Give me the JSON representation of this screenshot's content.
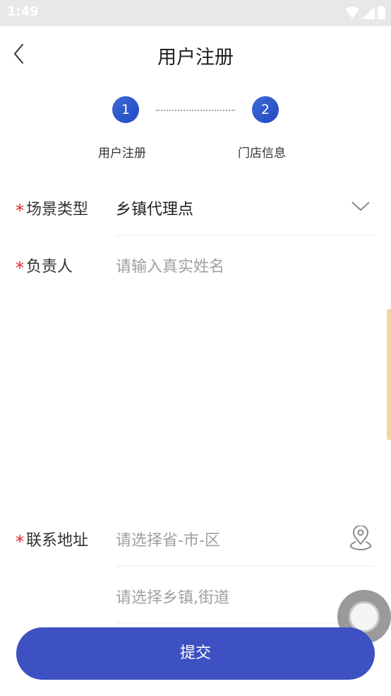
{
  "status_bar": {
    "time": "1:49"
  },
  "header": {
    "title": "用户注册"
  },
  "steps": [
    {
      "number": "1",
      "label": "用户注册"
    },
    {
      "number": "2",
      "label": "门店信息"
    }
  ],
  "form": {
    "required_mark": "*",
    "scene_type": {
      "label": "场景类型",
      "value": "乡镇代理点"
    },
    "owner": {
      "label": "负责人",
      "placeholder": "请输入真实姓名"
    },
    "address": {
      "label": "联系地址",
      "region_placeholder": "请选择省-市-区",
      "town_placeholder": "请选择乡镇,街道"
    }
  },
  "submit_label": "提交",
  "colors": {
    "accent": "#3d51c3",
    "step_blue": "#2a55c9",
    "required": "#e8212a",
    "placeholder": "#a0a0a0"
  }
}
